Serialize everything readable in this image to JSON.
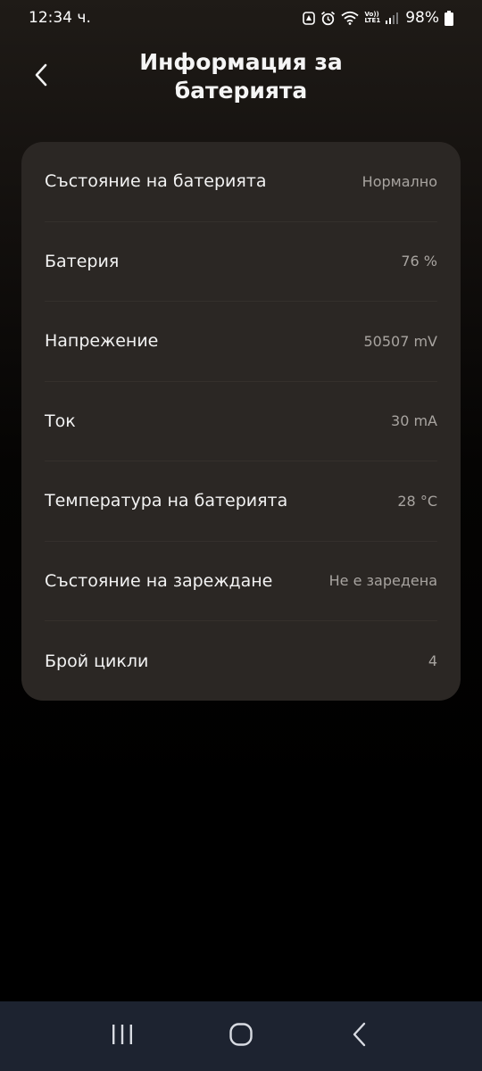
{
  "status_bar": {
    "time": "12:34 ч.",
    "lte_top": "Vo))",
    "lte_bottom": "LTE1",
    "battery_percent": "98%",
    "icons": [
      "notification-icon",
      "alarm-icon",
      "wifi-icon",
      "volte-icon",
      "signal-icon",
      "battery-icon"
    ]
  },
  "header": {
    "title_line1": "Информация за",
    "title_line2": "батерията",
    "back_icon": "chevron-left-icon"
  },
  "battery_info": {
    "rows": [
      {
        "label": "Състояние на батерията",
        "value": "Нормално"
      },
      {
        "label": "Батерия",
        "value": "76 %"
      },
      {
        "label": "Напрежение",
        "value": "50507 mV"
      },
      {
        "label": "Ток",
        "value": "30 mA"
      },
      {
        "label": "Температура на батерията",
        "value": "28 °C"
      },
      {
        "label": "Състояние на зареждане",
        "value": "Не е заредена"
      },
      {
        "label": "Брой цикли",
        "value": "4"
      }
    ]
  },
  "nav_bar": {
    "icons": [
      "recent-apps-icon",
      "home-icon",
      "back-icon"
    ]
  },
  "colors": {
    "card_background": "#2b2724",
    "nav_background": "#1d2330",
    "value_text": "#a8a4a0"
  }
}
